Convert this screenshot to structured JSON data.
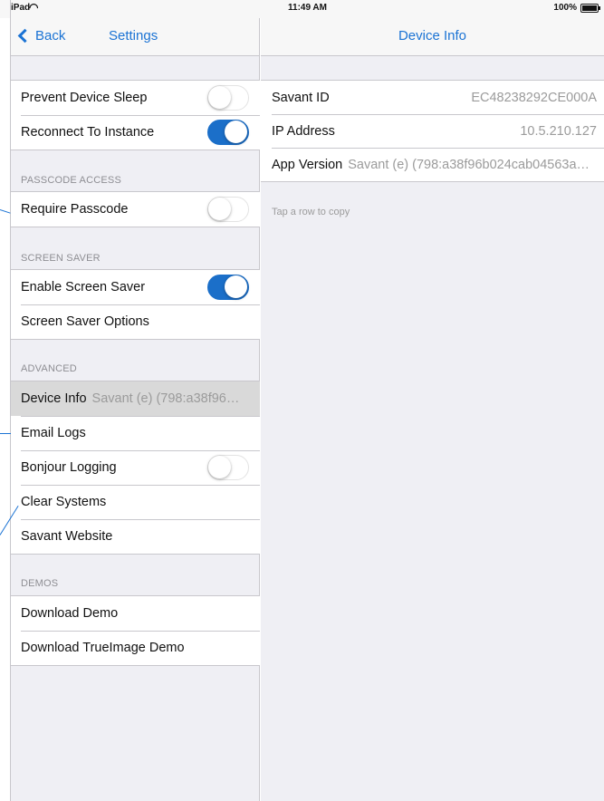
{
  "status_bar": {
    "device": "iPad",
    "wifi_icon": "wifi-icon",
    "time": "11:49 AM",
    "battery": "100%"
  },
  "colors": {
    "accent": "#1b73d4",
    "toggle_on": "#1b6fc9",
    "background": "#efeff4"
  },
  "master": {
    "back_label": "Back",
    "title": "Settings",
    "general": [
      {
        "label": "Prevent Device Sleep",
        "toggle": false
      },
      {
        "label": "Reconnect To Instance",
        "toggle": true
      }
    ],
    "passcode": {
      "header": "PASSCODE ACCESS",
      "rows": [
        {
          "label": "Require Passcode",
          "toggle": false
        }
      ]
    },
    "screen_saver": {
      "header": "SCREEN SAVER",
      "rows": [
        {
          "label": "Enable Screen Saver",
          "toggle": true
        },
        {
          "label": "Screen Saver Options"
        }
      ]
    },
    "advanced": {
      "header": "ADVANCED",
      "rows": [
        {
          "label": "Device Info",
          "detail": "Savant (e) (798:a38f96b…",
          "selected": true
        },
        {
          "label": "Email Logs"
        },
        {
          "label": "Bonjour Logging",
          "toggle": false
        },
        {
          "label": "Clear Systems"
        },
        {
          "label": "Savant Website"
        }
      ]
    },
    "demos": {
      "header": "DEMOS",
      "rows": [
        {
          "label": "Download Demo"
        },
        {
          "label": "Download TrueImage Demo"
        }
      ]
    }
  },
  "detail": {
    "title": "Device Info",
    "rows": [
      {
        "label": "Savant ID",
        "value": "EC48238292CE000A"
      },
      {
        "label": "IP Address",
        "value": "10.5.210.127"
      },
      {
        "label": "App Version",
        "value": "Savant (e) (798:a38f96b024cab04563ae…"
      }
    ],
    "footnote": "Tap a row to copy"
  }
}
